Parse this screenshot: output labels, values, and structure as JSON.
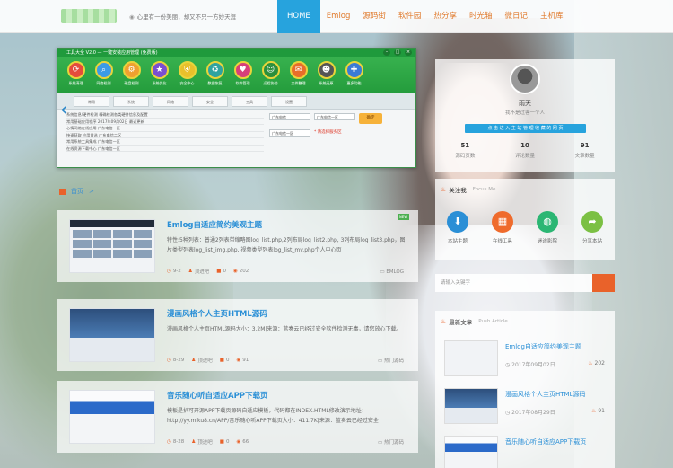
{
  "header": {
    "tagline": "心里有一份美丽，却又不只一方妙天涯",
    "nav": [
      "HOME",
      "Emlog",
      "源码街",
      "软件园",
      "热分享",
      "时光轴",
      "微日记",
      "主机库"
    ],
    "active_nav": "HOME"
  },
  "app_window": {
    "title": "工具大全 V2.0 — 一键安装应用管理 (免费版)",
    "tools": [
      "系统清理",
      "网络检测",
      "磁盘检测",
      "系统优化",
      "安全中心",
      "数据恢复",
      "软件管理",
      "远程协助",
      "文件整理",
      "系统还原",
      "更多功能"
    ],
    "tabs": [
      "常用",
      "系统",
      "网络",
      "安全",
      "工具",
      "设置"
    ],
    "rows": [
      "系统信息/硬件检测           精确检测各类硬件信息及配置",
      "常用基础应用程序            2017年09月02日 最近更新",
      "心情网络在线应用            广东电信一区",
      "快速获取 应用首选           广东电信二区",
      "常用系统工具集成            广东电信一区",
      "在线资源下载中心            广东电信一区"
    ],
    "selects": [
      "广东电信",
      "广东电信一区",
      "广东电信一区"
    ],
    "button": "确定",
    "note": "* 请选择服务区"
  },
  "breadcrumb": {
    "home": "首页",
    "sep": ">"
  },
  "posts": [
    {
      "title": "Emlog自适应简约美观主题",
      "excerpt": "特性:5种列表：普通2列表带缩略图log_list.php,2列布局log_list2.php, 3列布局log_list3.php，图片类型列表log_list_img.php, 视频类型列表log_list_mv.php个人中心页",
      "date": "9-2",
      "author": "顶进吧",
      "comments": "0",
      "views": "202",
      "category": "EMLOG",
      "flag": "NEW"
    },
    {
      "title": "漫画风格个人主页HTML源码",
      "excerpt": "漫画风格个人主页HTML源码大小：3.2M|来源：蓝奏云已经过安全软件检测无毒，请您放心下载。",
      "date": "8-29",
      "author": "顶进吧",
      "comments": "0",
      "views": "91",
      "category": "热门源码"
    },
    {
      "title": "音乐随心听自适应APP下载页",
      "excerpt": "模板是扒可开源APP下载页源码自适应模板，代码都在INDEX.HTML修改演示地址：http://yy.miku8.cn/APP/音乐随心听APP下载页大小：411.7K|来源：蓝奏云已经过安全",
      "date": "8-28",
      "author": "顶进吧",
      "comments": "0",
      "views": "66",
      "category": "热门源码"
    }
  ],
  "profile": {
    "name": "雨天",
    "desc": "我不是过客一个人",
    "button": "点 击 进 入 主 站 管 理 收 藏 的 网 页",
    "stats": [
      {
        "n": "51",
        "l": "源码页数"
      },
      {
        "n": "10",
        "l": "评论数量"
      },
      {
        "n": "91",
        "l": "文章数量"
      }
    ]
  },
  "follow": {
    "title": "关注我",
    "subtitle": "Focus Me",
    "items": [
      {
        "label": "本站主题",
        "icon": "download-icon",
        "color": "#2b8fd6",
        "glyph": "⬇"
      },
      {
        "label": "在线工具",
        "icon": "grid-icon",
        "color": "#ef6b2c",
        "glyph": "▦"
      },
      {
        "label": "迷途影院",
        "icon": "globe-icon",
        "color": "#2bb673",
        "glyph": "◍"
      },
      {
        "label": "分享本站",
        "icon": "share-icon",
        "color": "#7bc043",
        "glyph": "➦"
      }
    ]
  },
  "search": {
    "placeholder": "请输入关键字"
  },
  "latest": {
    "title": "最新文章",
    "subtitle": "Push Article",
    "items": [
      {
        "title": "Emlog自适应简约美观主题",
        "date": "2017年09月02日",
        "views": "202"
      },
      {
        "title": "漫画风格个人主页HTML源码",
        "date": "2017年08月29日",
        "views": "91"
      },
      {
        "title": "音乐随心听自适应APP下载页",
        "date": "2017年08月28日",
        "views": "66"
      }
    ]
  },
  "colors": {
    "accent": "#27a3dd",
    "orange": "#e9622a",
    "nav_text": "#e07a2c"
  }
}
